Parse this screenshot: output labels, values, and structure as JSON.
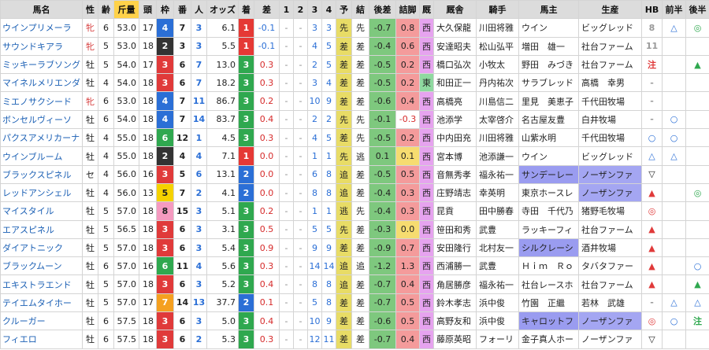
{
  "headers": [
    "馬名",
    "性",
    "齢",
    "斤量",
    "頭",
    "枠",
    "番",
    "人",
    "オッズ",
    "着",
    "差",
    "1",
    "2",
    "3",
    "4",
    "予",
    "結",
    "後差",
    "詰脚",
    "厩",
    "厩舎",
    "騎手",
    "馬主",
    "生産",
    "HB",
    "前半",
    "後半"
  ],
  "colors": {
    "waku": {
      "1": "#ffffff",
      "2": "#333333",
      "3": "#e03a3a",
      "4": "#2b6fd6",
      "5": "#f5d200",
      "6": "#2fa84f",
      "7": "#f5a020",
      "8": "#f59ac0"
    },
    "chaku": {
      "1": "#e53935",
      "2": "#2b6fd6",
      "3": "#2fa84f"
    },
    "shikyaku_hl": "#e8dc66",
    "tsumeashi_green": "#7ec87e",
    "tsumeashi_red": "#f49b9b",
    "tsumeashi_yellow": "#f6dc70",
    "tozai_east": "#8fd9a0",
    "tozai_west": "#e6a3ef",
    "triangle": "#2b6fd6",
    "circle": "#2b6fd6",
    "green_up": "#2fa84f"
  },
  "rows": [
    {
      "name": "ウインプリメーラ",
      "sex": "牝",
      "age": "6",
      "kinryo": "53.0",
      "tosu": "17",
      "waku": "4",
      "ban": "7",
      "ninki": "3",
      "odds": "6.1",
      "chaku": "1",
      "sa": "-0.1",
      "c1": "-",
      "c2": "-",
      "c3": "3",
      "c4": "3",
      "yoso": "先",
      "kekka": "先",
      "kosa": "-0.7",
      "tsume": "0.8",
      "tsume_c": "red",
      "tozai": "西",
      "chokyo": "大久保龍",
      "jockey": "川田将雅",
      "owner": "ウイン",
      "producer": "ビッグレッド",
      "hb": "8",
      "zen": "△",
      "kou": "◎"
    },
    {
      "name": "サウンドキアラ",
      "sex": "牝",
      "age": "5",
      "kinryo": "53.0",
      "tosu": "18",
      "waku": "2",
      "ban": "3",
      "ninki": "3",
      "odds": "5.5",
      "chaku": "1",
      "sa": "-0.1",
      "c1": "-",
      "c2": "-",
      "c3": "4",
      "c4": "5",
      "yoso": "差",
      "kekka": "差",
      "kosa": "-0.4",
      "tsume": "0.6",
      "tsume_c": "red",
      "tozai": "西",
      "chokyo": "安達昭夫",
      "jockey": "松山弘平",
      "owner": "増田　雄一",
      "producer": "社台ファーム",
      "hb": "11",
      "zen": "",
      "kou": ""
    },
    {
      "name": "ミッキーラブソング",
      "sex": "牡",
      "age": "5",
      "kinryo": "54.0",
      "tosu": "17",
      "waku": "3",
      "ban": "6",
      "ninki": "7",
      "odds": "13.0",
      "chaku": "3",
      "sa": "0.3",
      "c1": "-",
      "c2": "-",
      "c3": "2",
      "c4": "5",
      "yoso": "差",
      "kekka": "差",
      "kosa": "-0.5",
      "tsume": "0.2",
      "tsume_c": "red",
      "tozai": "西",
      "chokyo": "橋口弘次",
      "jockey": "小牧太",
      "owner": "野田　みづき",
      "producer": "社台ファーム",
      "hb": "注",
      "zen": "",
      "kou": "▲"
    },
    {
      "name": "マイネルメリエンダ",
      "sex": "牡",
      "age": "4",
      "kinryo": "54.0",
      "tosu": "18",
      "waku": "3",
      "ban": "6",
      "ninki": "7",
      "odds": "18.2",
      "chaku": "3",
      "sa": "0.3",
      "c1": "-",
      "c2": "-",
      "c3": "3",
      "c4": "4",
      "yoso": "差",
      "kekka": "差",
      "kosa": "-0.5",
      "tsume": "0.2",
      "tsume_c": "red",
      "tozai": "東",
      "chokyo": "和田正一",
      "jockey": "丹内祐次",
      "owner": "サラブレッド",
      "producer": "高橋　幸男",
      "hb": "-",
      "zen": "",
      "kou": ""
    },
    {
      "name": "ミエノサクシード",
      "sex": "牝",
      "age": "6",
      "kinryo": "53.0",
      "tosu": "18",
      "waku": "4",
      "ban": "7",
      "ninki": "11",
      "odds": "86.7",
      "chaku": "3",
      "sa": "0.2",
      "c1": "-",
      "c2": "-",
      "c3": "10",
      "c4": "9",
      "yoso": "差",
      "kekka": "差",
      "kosa": "-0.6",
      "tsume": "0.4",
      "tsume_c": "red",
      "tozai": "西",
      "chokyo": "高橋亮",
      "jockey": "川島信二",
      "owner": "里見　美恵子",
      "producer": "千代田牧場",
      "hb": "-",
      "zen": "",
      "kou": ""
    },
    {
      "name": "ボンセルヴィーソ",
      "sex": "牡",
      "age": "6",
      "kinryo": "54.0",
      "tosu": "18",
      "waku": "4",
      "ban": "7",
      "ninki": "14",
      "odds": "83.7",
      "chaku": "3",
      "sa": "0.4",
      "c1": "-",
      "c2": "-",
      "c3": "2",
      "c4": "2",
      "yoso": "先",
      "kekka": "先",
      "kosa": "-0.1",
      "tsume": "-0.3",
      "tsume_c": "white",
      "tozai": "西",
      "chokyo": "池添学",
      "jockey": "太宰啓介",
      "owner": "名古屋友豊",
      "producer": "白井牧場",
      "hb": "-",
      "zen": "○",
      "kou": ""
    },
    {
      "name": "パクスアメリカーナ",
      "sex": "牡",
      "age": "4",
      "kinryo": "55.0",
      "tosu": "18",
      "waku": "6",
      "ban": "12",
      "ninki": "1",
      "odds": "4.5",
      "chaku": "3",
      "sa": "0.3",
      "c1": "-",
      "c2": "-",
      "c3": "4",
      "c4": "5",
      "yoso": "差",
      "kekka": "先",
      "kosa": "-0.5",
      "tsume": "0.2",
      "tsume_c": "red",
      "tozai": "西",
      "chokyo": "中内田充",
      "jockey": "川田将雅",
      "owner": "山紫水明",
      "producer": "千代田牧場",
      "hb": "○",
      "zen": "○",
      "kou": ""
    },
    {
      "name": "ウインブルーム",
      "sex": "牡",
      "age": "4",
      "kinryo": "55.0",
      "tosu": "18",
      "waku": "2",
      "ban": "4",
      "ninki": "4",
      "odds": "7.1",
      "chaku": "1",
      "sa": "0.0",
      "c1": "-",
      "c2": "-",
      "c3": "1",
      "c4": "1",
      "yoso": "先",
      "kekka": "逃",
      "kosa": "0.1",
      "tsume": "0.1",
      "tsume_c": "yellow",
      "tozai": "西",
      "chokyo": "宮本博",
      "jockey": "池添謙一",
      "owner": "ウイン",
      "producer": "ビッグレッド",
      "hb": "△",
      "zen": "△",
      "kou": ""
    },
    {
      "name": "ブラックスピネル",
      "sex": "セ",
      "age": "4",
      "kinryo": "56.0",
      "tosu": "16",
      "waku": "3",
      "ban": "5",
      "ninki": "6",
      "odds": "13.1",
      "chaku": "2",
      "sa": "0.0",
      "c1": "-",
      "c2": "-",
      "c3": "6",
      "c4": "8",
      "yoso": "追",
      "kekka": "差",
      "kosa": "-0.5",
      "tsume": "0.5",
      "tsume_c": "red",
      "tozai": "西",
      "chokyo": "音無秀孝",
      "jockey": "福永祐一",
      "owner": "サンデーレー",
      "producer": "ノーザンファ",
      "hb": "▽",
      "zen": "",
      "kou": "",
      "hl": true
    },
    {
      "name": "レッドアンシェル",
      "sex": "牡",
      "age": "4",
      "kinryo": "56.0",
      "tosu": "13",
      "waku": "5",
      "ban": "7",
      "ninki": "2",
      "odds": "4.1",
      "chaku": "2",
      "sa": "0.0",
      "c1": "-",
      "c2": "-",
      "c3": "8",
      "c4": "8",
      "yoso": "追",
      "kekka": "差",
      "kosa": "-0.4",
      "tsume": "0.3",
      "tsume_c": "red",
      "tozai": "西",
      "chokyo": "庄野靖志",
      "jockey": "幸英明",
      "owner": "東京ホースレ",
      "producer": "ノーザンファ",
      "hb": "▲",
      "zen": "",
      "kou": "◎",
      "hl_prod": true
    },
    {
      "name": "マイスタイル",
      "sex": "牡",
      "age": "5",
      "kinryo": "57.0",
      "tosu": "18",
      "waku": "8",
      "ban": "15",
      "ninki": "3",
      "odds": "5.1",
      "chaku": "3",
      "sa": "0.2",
      "c1": "-",
      "c2": "-",
      "c3": "1",
      "c4": "1",
      "yoso": "逃",
      "kekka": "先",
      "kosa": "-0.4",
      "tsume": "0.3",
      "tsume_c": "red",
      "tozai": "西",
      "chokyo": "昆貢",
      "jockey": "田中勝春",
      "owner": "寺田　千代乃",
      "producer": "猪野毛牧場",
      "hb": "◎",
      "zen": "",
      "kou": ""
    },
    {
      "name": "エアスピネル",
      "sex": "牡",
      "age": "5",
      "kinryo": "56.5",
      "tosu": "18",
      "waku": "3",
      "ban": "6",
      "ninki": "3",
      "odds": "3.1",
      "chaku": "3",
      "sa": "0.5",
      "c1": "-",
      "c2": "-",
      "c3": "5",
      "c4": "5",
      "yoso": "先",
      "kekka": "差",
      "kosa": "-0.3",
      "tsume": "0.0",
      "tsume_c": "yellow",
      "tozai": "西",
      "chokyo": "笹田和秀",
      "jockey": "武豊",
      "owner": "ラッキーフィ",
      "producer": "社台ファーム",
      "hb": "▲",
      "zen": "",
      "kou": ""
    },
    {
      "name": "ダイアトニック",
      "sex": "牡",
      "age": "5",
      "kinryo": "57.0",
      "tosu": "18",
      "waku": "3",
      "ban": "6",
      "ninki": "3",
      "odds": "5.4",
      "chaku": "3",
      "sa": "0.9",
      "c1": "-",
      "c2": "-",
      "c3": "9",
      "c4": "9",
      "yoso": "差",
      "kekka": "差",
      "kosa": "-0.9",
      "tsume": "0.7",
      "tsume_c": "red",
      "tozai": "西",
      "chokyo": "安田隆行",
      "jockey": "北村友一",
      "owner": "シルクレーシ",
      "producer": "酒井牧場",
      "hb": "▲",
      "zen": "",
      "kou": "",
      "hl_owner": true
    },
    {
      "name": "ブラックムーン",
      "sex": "牡",
      "age": "6",
      "kinryo": "57.0",
      "tosu": "16",
      "waku": "6",
      "ban": "11",
      "ninki": "4",
      "odds": "5.6",
      "chaku": "3",
      "sa": "0.3",
      "c1": "-",
      "c2": "-",
      "c3": "14",
      "c4": "14",
      "yoso": "追",
      "kekka": "追",
      "kosa": "-1.2",
      "tsume": "1.3",
      "tsume_c": "red",
      "tozai": "西",
      "chokyo": "西浦勝一",
      "jockey": "武豊",
      "owner": "Ｈｉｍ　Ｒｏ",
      "producer": "タバタファー",
      "hb": "▲",
      "zen": "",
      "kou": "○"
    },
    {
      "name": "エキストラエンド",
      "sex": "牡",
      "age": "5",
      "kinryo": "57.0",
      "tosu": "18",
      "waku": "3",
      "ban": "6",
      "ninki": "3",
      "odds": "5.2",
      "chaku": "3",
      "sa": "0.4",
      "c1": "-",
      "c2": "-",
      "c3": "8",
      "c4": "8",
      "yoso": "追",
      "kekka": "差",
      "kosa": "-0.7",
      "tsume": "0.4",
      "tsume_c": "red",
      "tozai": "西",
      "chokyo": "角居勝彦",
      "jockey": "福永祐一",
      "owner": "社台レースホ",
      "producer": "社台ファーム",
      "hb": "▲",
      "zen": "",
      "kou": "▲"
    },
    {
      "name": "テイエムタイホー",
      "sex": "牡",
      "age": "5",
      "kinryo": "57.0",
      "tosu": "17",
      "waku": "7",
      "ban": "14",
      "ninki": "13",
      "odds": "37.7",
      "chaku": "2",
      "sa": "0.1",
      "c1": "-",
      "c2": "-",
      "c3": "5",
      "c4": "8",
      "yoso": "差",
      "kekka": "差",
      "kosa": "-0.7",
      "tsume": "0.5",
      "tsume_c": "red",
      "tozai": "西",
      "chokyo": "鈴木孝志",
      "jockey": "浜中俊",
      "owner": "竹園　正繼",
      "producer": "若林　武雄",
      "hb": "-",
      "zen": "△",
      "kou": "△"
    },
    {
      "name": "クルーガー",
      "sex": "牡",
      "age": "6",
      "kinryo": "57.5",
      "tosu": "18",
      "waku": "3",
      "ban": "6",
      "ninki": "3",
      "odds": "5.0",
      "chaku": "3",
      "sa": "0.4",
      "c1": "-",
      "c2": "-",
      "c3": "10",
      "c4": "9",
      "yoso": "差",
      "kekka": "差",
      "kosa": "-0.6",
      "tsume": "0.5",
      "tsume_c": "red",
      "tozai": "西",
      "chokyo": "高野友和",
      "jockey": "浜中俊",
      "owner": "キャロットフ",
      "producer": "ノーザンファ",
      "hb": "◎",
      "zen": "○",
      "kou": "注",
      "hl": true
    },
    {
      "name": "フィエロ",
      "sex": "牡",
      "age": "6",
      "kinryo": "57.5",
      "tosu": "18",
      "waku": "3",
      "ban": "6",
      "ninki": "2",
      "odds": "5.3",
      "chaku": "3",
      "sa": "0.3",
      "c1": "-",
      "c2": "-",
      "c3": "12",
      "c4": "11",
      "yoso": "差",
      "kekka": "差",
      "kosa": "-0.7",
      "tsume": "0.4",
      "tsume_c": "red",
      "tozai": "西",
      "chokyo": "藤原英昭",
      "jockey": "フォーリ",
      "owner": "金子真人ホー",
      "producer": "ノーザンファ",
      "hb": "▽",
      "zen": "",
      "kou": ""
    }
  ]
}
